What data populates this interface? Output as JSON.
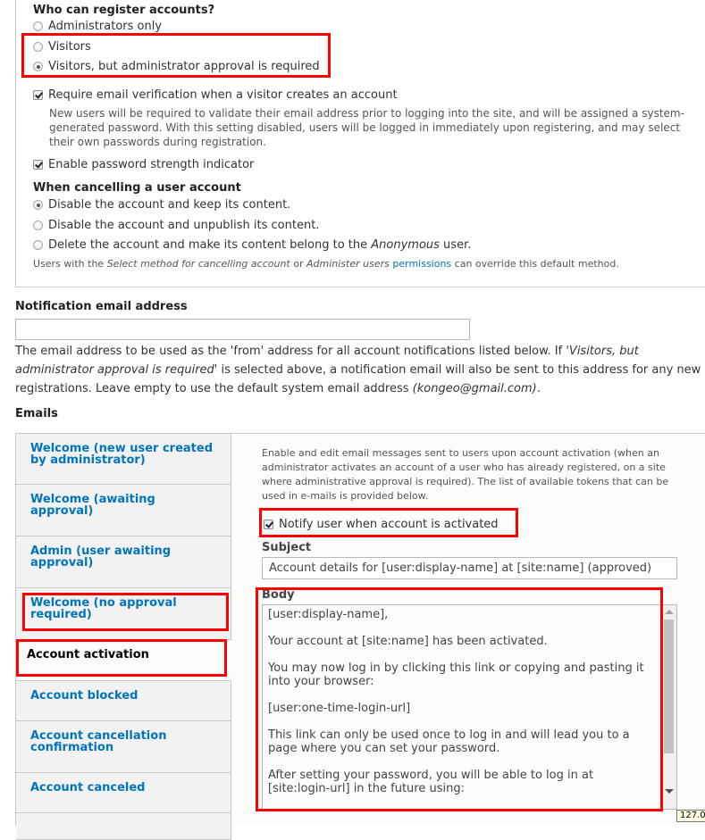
{
  "registration": {
    "heading": "Who can register accounts?",
    "options": [
      {
        "label": "Administrators only",
        "selected": false
      },
      {
        "label": "Visitors",
        "selected": false
      },
      {
        "label": "Visitors, but administrator approval is required",
        "selected": true
      }
    ],
    "email_verification": {
      "label": "Require email verification when a visitor creates an account",
      "checked": true,
      "description": "New users will be required to validate their email address prior to logging into the site, and will be assigned a system-generated password. With this setting disabled, users will be logged in immediately upon registering, and may select their own passwords during registration."
    },
    "password_strength": {
      "label": "Enable password strength indicator",
      "checked": true
    }
  },
  "cancellation": {
    "heading": "When cancelling a user account",
    "options": [
      {
        "label": "Disable the account and keep its content.",
        "selected": true
      },
      {
        "label": "Disable the account and unpublish its content.",
        "selected": false
      },
      {
        "label_before": "Delete the account and make its content belong to the ",
        "label_em": "Anonymous",
        "label_after": " user.",
        "selected": false
      }
    ],
    "help": {
      "t1": "Users with the ",
      "em1": "Select method for cancelling account",
      "t2": " or ",
      "em2": "Administer users",
      "t3": " ",
      "link": "permissions",
      "t4": " can override this default method."
    }
  },
  "notification": {
    "label": "Notification email address",
    "value": "",
    "placeholder": "",
    "desc": {
      "t1": "The email address to be used as the 'from' address for all account notifications listed below. If '",
      "em1": "Visitors, but administrator approval is required",
      "t2": "' is selected above, a notification email will also be sent to this address for any new registrations. Leave empty to use the default system email address ",
      "em2": "(kongeo@gmail.com)",
      "t3": "."
    }
  },
  "emails": {
    "heading": "Emails",
    "tabs": [
      {
        "label": "Welcome (new user created by administrator)",
        "active": false
      },
      {
        "label": "Welcome (awaiting approval)",
        "active": false
      },
      {
        "label": "Admin (user awaiting approval)",
        "active": false
      },
      {
        "label": "Welcome (no approval required)",
        "active": false
      },
      {
        "label": "Account activation",
        "active": true
      },
      {
        "label": "Account blocked",
        "active": false
      },
      {
        "label": "Account cancellation confirmation",
        "active": false
      },
      {
        "label": "Account canceled",
        "active": false
      }
    ],
    "pane": {
      "description": "Enable and edit email messages sent to users upon account activation (when an administrator activates an account of a user who has already registered, on a site where administrative approval is required). The list of available tokens that can be used in e-mails is provided below.",
      "notify": {
        "label": "Notify user when account is activated",
        "checked": true
      },
      "subject_label": "Subject",
      "subject_value": "Account details for [user:display-name] at [site:name] (approved)",
      "body_label": "Body",
      "body_value": "[user:display-name],\n\nYour account at [site:name] has been activated.\n\nYou may now log in by clicking this link or copying and pasting it into your browser:\n\n[user:one-time-login-url]\n\nThis link can only be used once to log in and will lead you to a page where you can set your password.\n\nAfter setting your password, you will be able to log in at [site:login-url] in the future using:"
    }
  },
  "tooltip": "127.0",
  "colors": {
    "link": "#0074bd",
    "highlight": "#ff0000"
  }
}
